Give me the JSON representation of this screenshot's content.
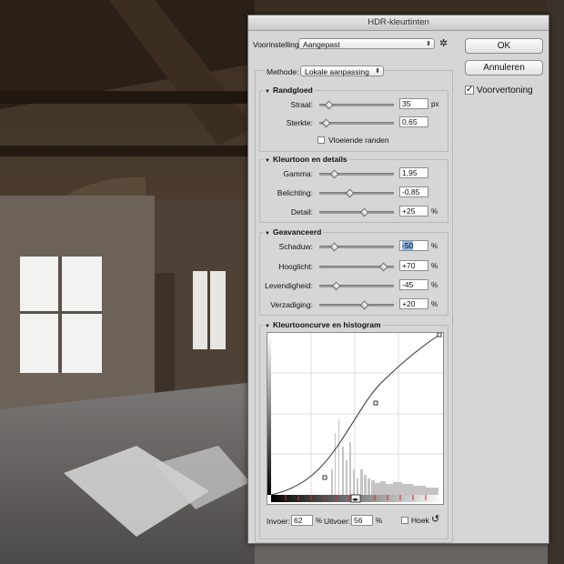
{
  "dialog": {
    "title": "HDR-kleurtinten",
    "preset_label": "Voorinstelling:",
    "preset_value": "Aangepast",
    "method_label": "Methode:",
    "method_value": "Lokale aanpassing",
    "ok_label": "OK",
    "cancel_label": "Annuleren",
    "preview_label": "Voorvertoning",
    "preview_checked": true
  },
  "edge_glow": {
    "title": "Randgloed",
    "radius_label": "Straal:",
    "radius_value": "35",
    "radius_unit": "px",
    "radius_level": 0.12,
    "strength_label": "Sterkte:",
    "strength_value": "0,65",
    "strength_level": 0.09,
    "smooth_label": "Vloeiende randen"
  },
  "tone_detail": {
    "title": "Kleurtoon en details",
    "gamma_label": "Gamma:",
    "gamma_value": "1,95",
    "gamma_level": 0.2,
    "exposure_label": "Belichting:",
    "exposure_value": "-0,85",
    "exposure_level": 0.4,
    "detail_label": "Detail:",
    "detail_value": "+25",
    "detail_unit": "%",
    "detail_level": 0.6
  },
  "advanced": {
    "title": "Geavanceerd",
    "shadow_label": "Schaduw:",
    "shadow_value": "-50",
    "shadow_level": 0.2,
    "highlight_label": "Hooglicht:",
    "highlight_value": "+70",
    "highlight_level": 0.85,
    "vibrance_label": "Levendigheid:",
    "vibrance_value": "-45",
    "vibrance_level": 0.22,
    "saturation_label": "Verzadiging:",
    "saturation_value": "+20",
    "saturation_level": 0.6,
    "unit": "%"
  },
  "curve": {
    "title": "Kleurtooncurve en histogram",
    "input_label": "Invoer:",
    "input_value": "62",
    "output_label": "Uitvoer:",
    "output_value": "56",
    "unit": "%",
    "corner_label": "Hoek"
  },
  "icons": {
    "gear": "gear-icon",
    "reset": "reset-icon"
  }
}
